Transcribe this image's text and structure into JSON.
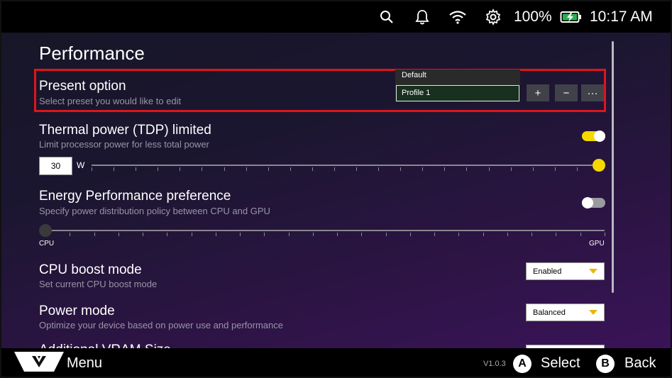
{
  "status": {
    "icons": [
      "search-icon",
      "bell-icon",
      "wifi-icon",
      "gear-icon",
      "battery-charging-icon"
    ],
    "battery": "100%",
    "time": "10:17 AM"
  },
  "page": {
    "title": "Performance"
  },
  "preset": {
    "title": "Present option",
    "subtitle": "Select preset you would like to edit",
    "options": [
      "Default",
      "Profile 1"
    ],
    "selected": "Profile 1",
    "add_label": "+",
    "remove_label": "−",
    "more_label": "···"
  },
  "tdp": {
    "title": "Thermal power (TDP) limited",
    "subtitle": "Limit processor power for less total power",
    "enabled": true,
    "value": "30",
    "unit": "W",
    "slider_fraction": 1.0
  },
  "epp": {
    "title": "Energy Performance preference",
    "subtitle": "Specify power distribution policy between CPU and GPU",
    "enabled": false,
    "slider_fraction": 0.0,
    "min_label": "CPU",
    "max_label": "GPU"
  },
  "boost": {
    "title": "CPU boost mode",
    "subtitle": "Set current CPU boost mode",
    "value": "Enabled"
  },
  "power": {
    "title": "Power mode",
    "subtitle": "Optimize your device based on power use and performance",
    "value": "Balanced"
  },
  "vram": {
    "title": "Additional VRAM Size"
  },
  "footer": {
    "menu_label": "Menu",
    "version": "V1.0.3",
    "a_button": "A",
    "select_label": "Select",
    "b_button": "B",
    "back_label": "Back"
  },
  "colors": {
    "accent": "#f5d800",
    "highlight": "#e0141b",
    "toggle_on": "#f5d800",
    "toggle_off": "#9a9aa0"
  }
}
